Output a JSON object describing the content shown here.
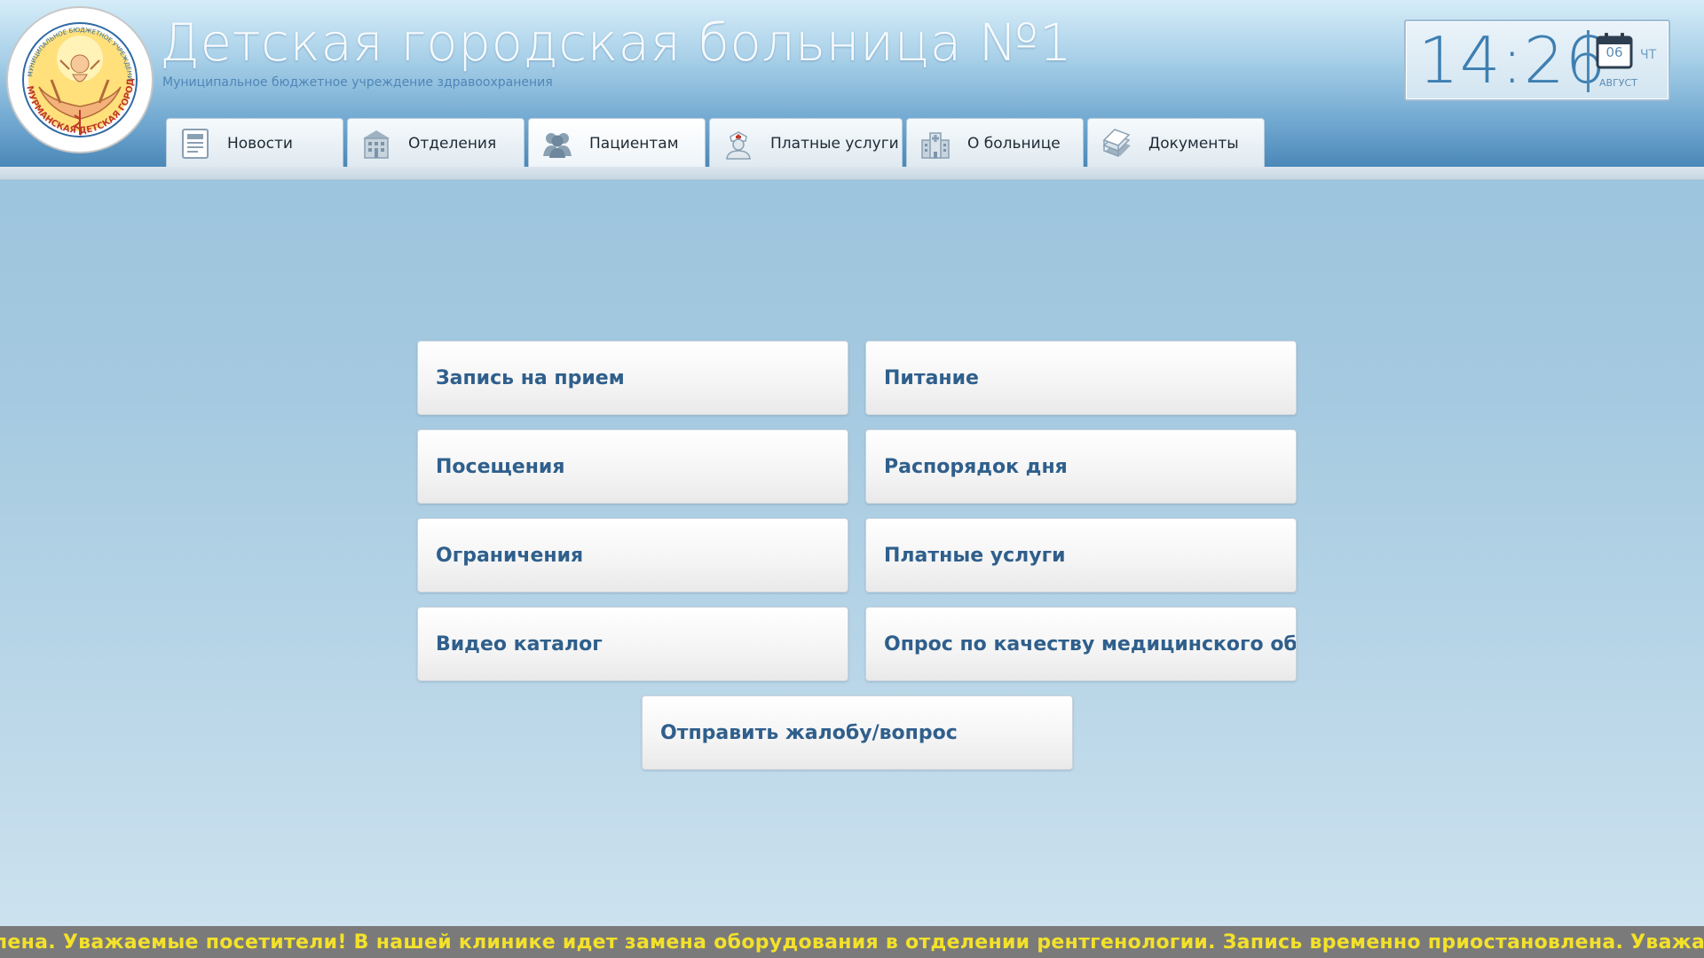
{
  "header": {
    "title": "Детская городская больница №1",
    "subtitle": "Муниципальное бюджетное учреждение здравоохранения",
    "logo_text": "МУНИЦИПАЛЬНОЕ БЮДЖЕТНОЕ УЧРЕЖДЕНИЕ ЗДРАВООХРАНЕНИЯ МУРМАНСКАЯ ДЕТСКАЯ ГОРОДСКАЯ БОЛЬНИЦА"
  },
  "clock": {
    "time": "14:26",
    "day": "06",
    "weekday": "ЧТ",
    "month": "АВГУСТ"
  },
  "nav": {
    "tabs": [
      {
        "label": "Новости",
        "icon": "newspaper-icon"
      },
      {
        "label": "Отделения",
        "icon": "building-icon"
      },
      {
        "label": "Пациентам",
        "icon": "people-icon",
        "active": true
      },
      {
        "label": "Платные услуги",
        "icon": "nurse-icon"
      },
      {
        "label": "О больнице",
        "icon": "hospital-icon"
      },
      {
        "label": "Документы",
        "icon": "documents-icon"
      }
    ]
  },
  "menu": {
    "items": [
      "Запись на прием",
      "Питание",
      "Посещения",
      "Распорядок дня",
      "Ограничения",
      "Платные услуги",
      "Видео каталог",
      "Опрос по качеству медицинского обслуживания",
      "Отправить жалобу/вопрос"
    ]
  },
  "ticker": {
    "text": "лена.  Уважаемые посетители! В нашей клинике идет замена оборудования в отделении рентгенологии. Запись временно приостановлена.  Уважаемые посетители!"
  },
  "colors": {
    "accent": "#2f5f8c",
    "ticker_text": "#f3e12b",
    "ticker_bg": "#7a7a7a"
  }
}
